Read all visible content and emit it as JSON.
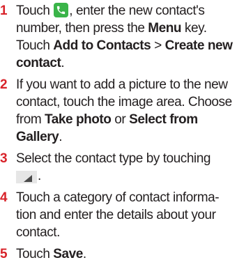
{
  "steps": [
    {
      "num": "1",
      "t1": "Touch ",
      "icon1": "phone-icon",
      "t2": ", enter the new contact's number, then press the ",
      "b1": "Menu",
      "t3": " key. Touch ",
      "b2": "Add to Contacts",
      "t4": " > ",
      "b3": "Create new contact",
      "t5": "."
    },
    {
      "num": "2",
      "t1": "If you want to add a picture to the new contact, touch the image area. Choose from ",
      "b1": "Take photo",
      "t2": " or ",
      "b2": "Select from Gallery",
      "t3": "."
    },
    {
      "num": "3",
      "t1": "Select the contact type by touching ",
      "icon1": "corner-triangle-icon",
      "t2": "."
    },
    {
      "num": "4",
      "t1": "Touch a category of contact informa-tion and enter the details about your contact."
    },
    {
      "num": "5",
      "t1": "Touch ",
      "b1": "Save",
      "t2": "."
    }
  ],
  "colors": {
    "step_number": "#d8232a",
    "phone_icon_bg": "#3ab449",
    "text": "#231f20"
  }
}
